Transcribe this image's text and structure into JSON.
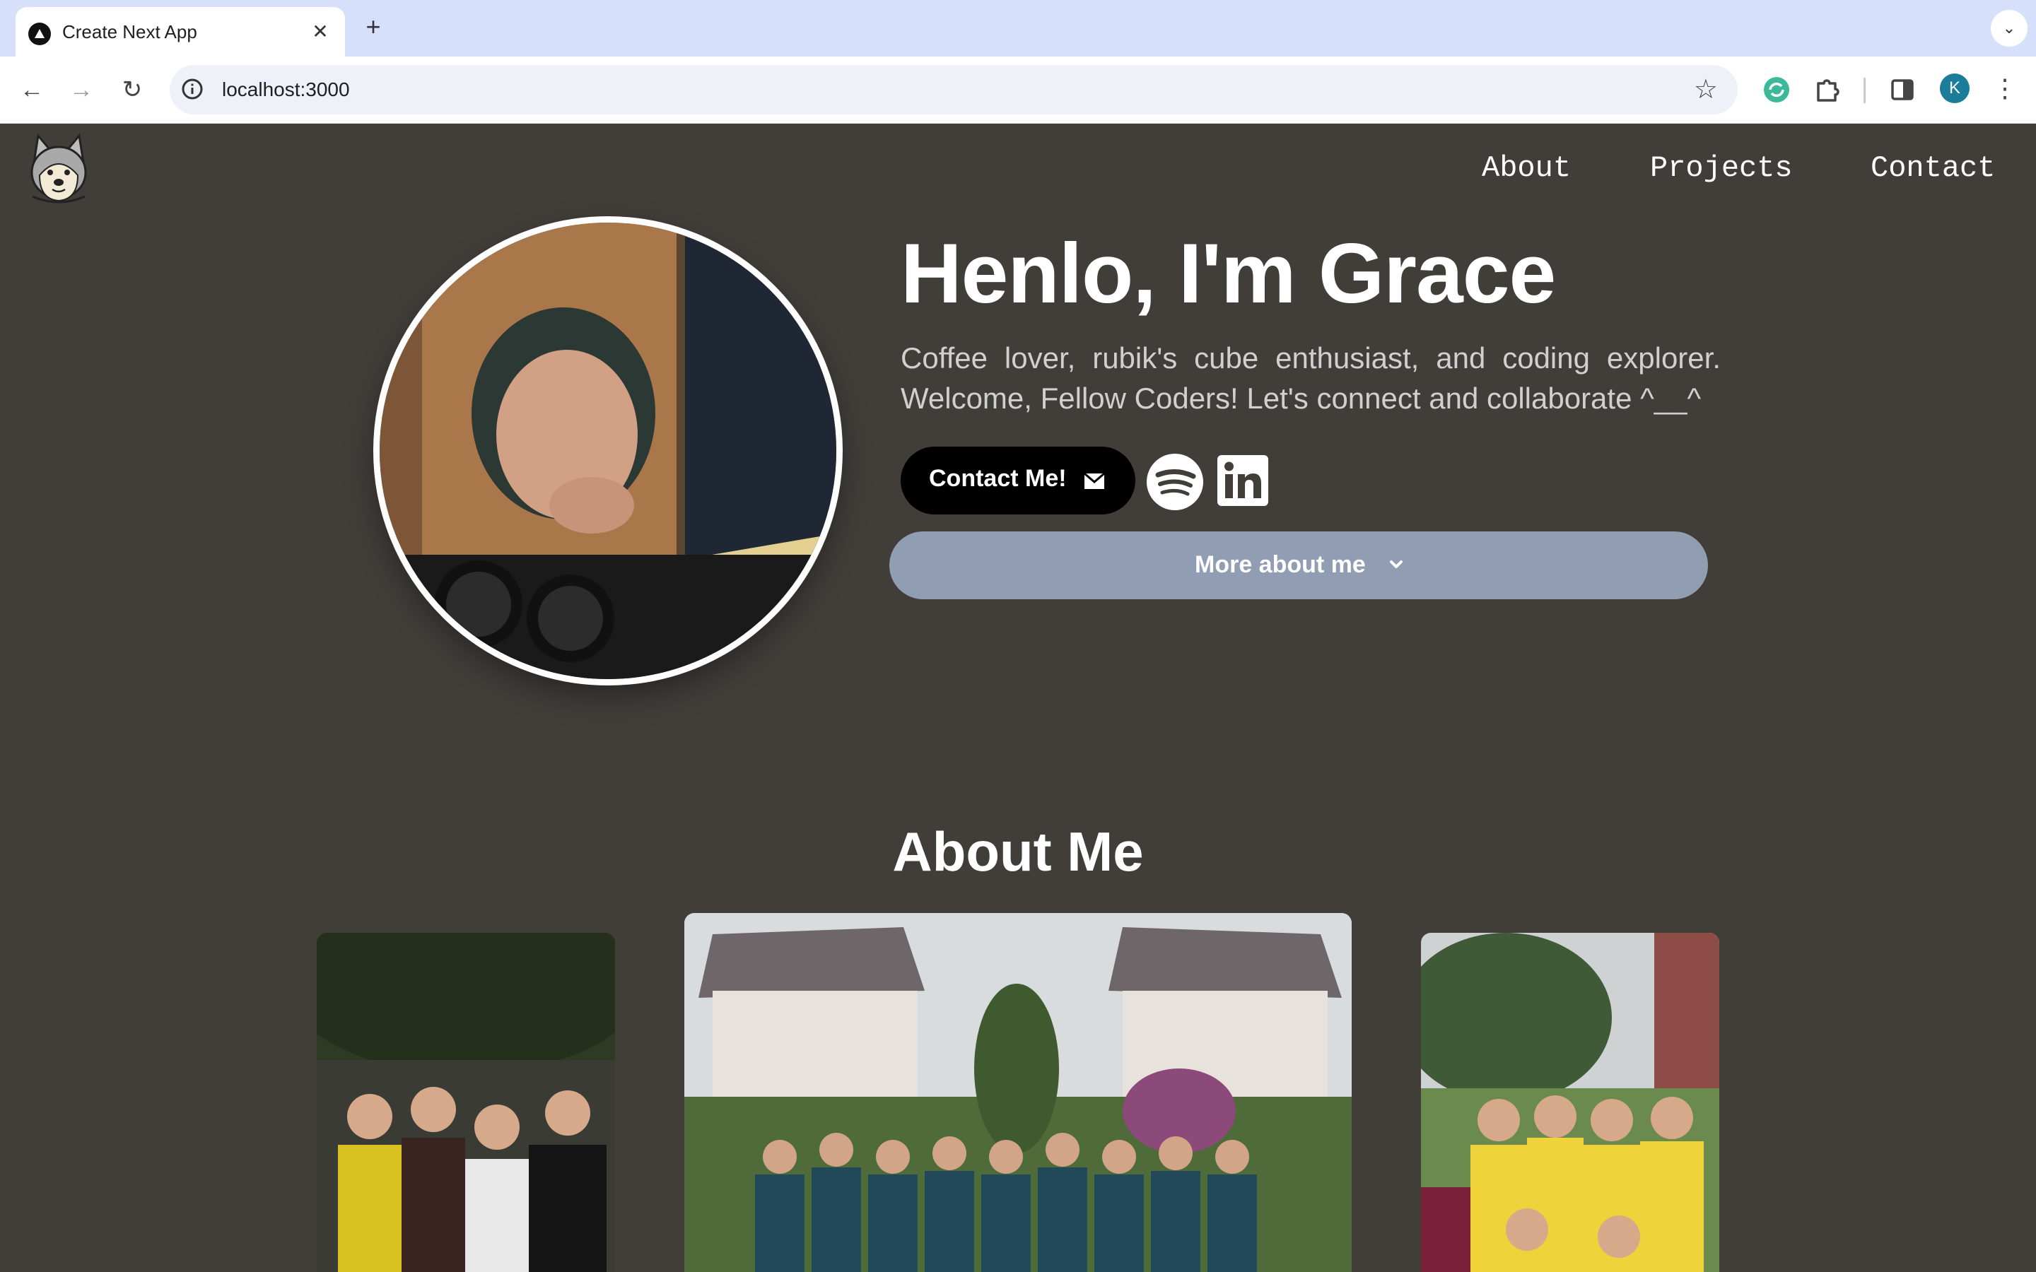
{
  "browser": {
    "tab_title": "Create Next App",
    "tab_close": "✕",
    "new_tab": "+",
    "tab_search": "⌄",
    "url": "localhost:3000",
    "profile_initial": "K",
    "back": "←",
    "forward": "→",
    "reload": "↻",
    "star": "☆",
    "menu": "⋮"
  },
  "nav": {
    "links": [
      "About",
      "Projects",
      "Contact"
    ]
  },
  "hero": {
    "title": "Henlo, I'm Grace",
    "bio": "Coffee lover, rubik's cube enthusiast, and coding explorer. Welcome, Fellow Coders! Let's connect and collaborate ^__^",
    "contact_button": "Contact Me!",
    "more_button": "More about me"
  },
  "about": {
    "title": "About Me"
  },
  "colors": {
    "page_bg": "#413e3a",
    "more_button_bg": "#909db2",
    "contact_button_bg": "#000000",
    "tabbar_bg": "#d6e0fb"
  },
  "icons": [
    "husky-logo-icon",
    "mail-icon",
    "spotify-icon",
    "linkedin-icon",
    "chevron-down-icon",
    "star-icon",
    "extensions-icon",
    "sidebar-icon",
    "sync-icon",
    "info-icon"
  ]
}
